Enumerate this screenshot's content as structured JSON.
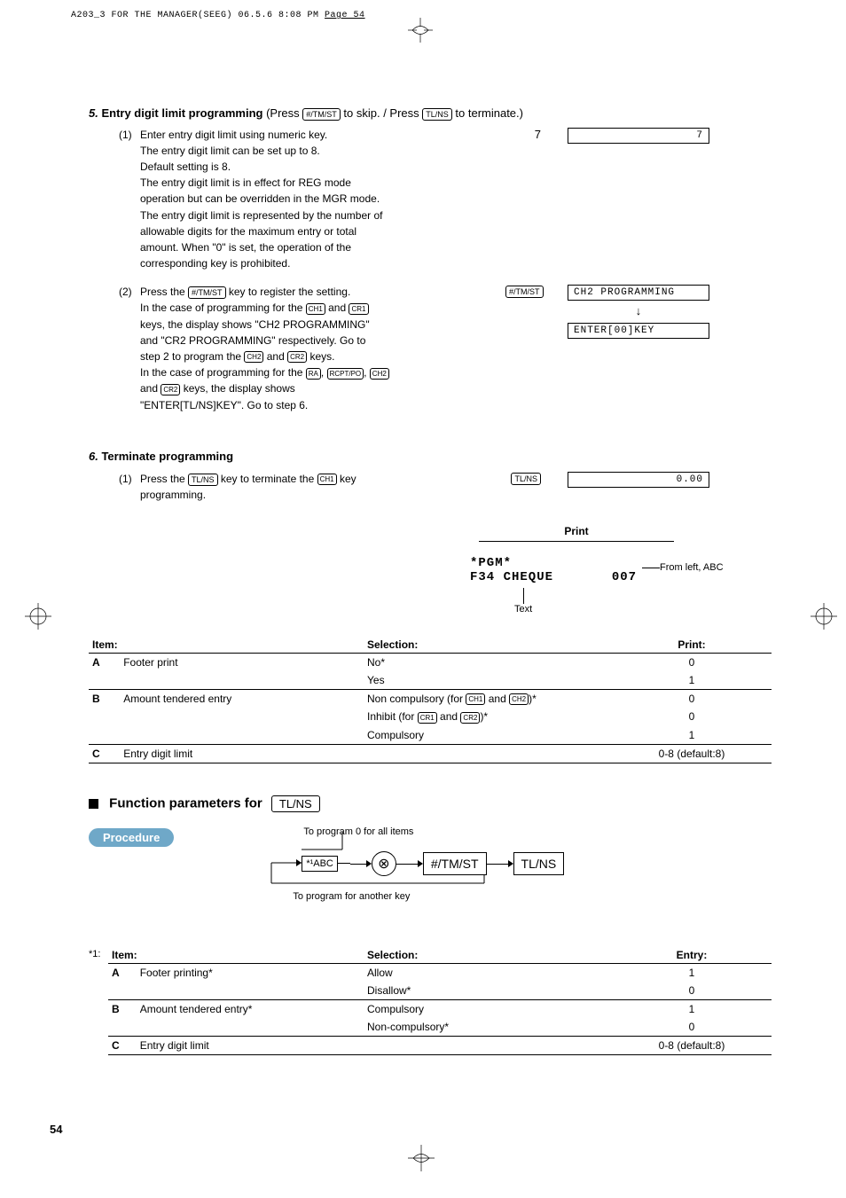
{
  "header": {
    "doc_header": "A203_3 FOR THE MANAGER(SEEG)  06.5.6 8:08 PM  ",
    "doc_header_page": "Page 54"
  },
  "step5": {
    "title_prefix": "5.",
    "title_bold": " Entry digit limit programming",
    "title_rest1": " (Press ",
    "key1": "#/TM/ST",
    "title_rest2": " to skip. / Press ",
    "key2": "TL/NS",
    "title_rest3": " to terminate.)",
    "s1": {
      "num": "(1)",
      "l1": "Enter entry digit limit using numeric key.",
      "l2": "The entry digit limit can be set up to 8.",
      "l3": "Default setting is 8.",
      "l4": "The entry digit limit is in effect for REG mode",
      "l5": "operation but can be overridden in the MGR mode.",
      "l6": "The entry digit limit is represented by the number of",
      "l7": "allowable digits for the maximum entry or total",
      "l8": "amount.  When \"0\" is set, the operation of the",
      "l9": "corresponding key is prohibited.",
      "right_num": "7",
      "right_disp": "7"
    },
    "s2": {
      "num": "(2)",
      "l1a": "Press the ",
      "l1key": "#/TM/ST",
      "l1b": " key to register the setting.",
      "l2a": "In the case of programming for the ",
      "l2key1": "CH1",
      "l2mid": " and ",
      "l2key2": "CR1",
      "l3": "keys, the display shows \"CH2 PROGRAMMING\"",
      "l4": "and \"CR2 PROGRAMMING\" respectively.  Go to",
      "l5a": "step 2 to program the ",
      "l5key1": "CH2",
      "l5mid": " and ",
      "l5key2": "CR2",
      "l5b": " keys.",
      "l6a": "In the case of programming for the ",
      "l6key1": "RA",
      "l6key2": "RCPT/PO",
      "l6key3": "CH2",
      "l7a": "and ",
      "l7key": "CR2",
      "l7b": " keys, the display shows",
      "l8": "\"ENTER[TL/NS]KEY\".  Go to step 6.",
      "right_key": "#/TM/ST",
      "right_disp1": "CH2 PROGRAMMING",
      "right_disp2": "ENTER[00]KEY"
    }
  },
  "step6": {
    "title_prefix": "6.",
    "title_bold": " Terminate programming",
    "s1": {
      "num": "(1)",
      "l1a": "Press the ",
      "l1key": "TL/NS",
      "l1b": " key to terminate the ",
      "l1key2": "CH1",
      "l1c": " key",
      "l2": "programming.",
      "right_key": "TL/NS",
      "right_disp": "0.00"
    },
    "print": {
      "title": "Print",
      "line1": "*PGM*",
      "line2": "F34 CHEQUE       007",
      "callout_text": "Text",
      "callout_right": "From left, ABC"
    }
  },
  "table1": {
    "h_item": "Item:",
    "h_sel": "Selection:",
    "h_print": "Print:",
    "rows": [
      {
        "code": "A",
        "item": "Footer print",
        "sel": "No*",
        "print": "0"
      },
      {
        "code": "",
        "item": "",
        "sel": "Yes",
        "print": "1"
      },
      {
        "code": "B",
        "item": "Amount tendered entry",
        "sel_pre": "Non compulsory (for ",
        "sel_k1": "CH1",
        "sel_mid": " and ",
        "sel_k2": "CH2",
        "sel_post": ")*",
        "print": "0"
      },
      {
        "code": "",
        "item": "",
        "sel_pre": "Inhibit (for ",
        "sel_k1": "CR1",
        "sel_mid": " and ",
        "sel_k2": "CR2",
        "sel_post": ")*",
        "print": "0"
      },
      {
        "code": "",
        "item": "",
        "sel": "Compulsory",
        "print": "1"
      },
      {
        "code": "C",
        "item": "Entry digit limit",
        "sel": "",
        "print": "0-8 (default:8)"
      }
    ]
  },
  "func": {
    "title_pre": "Function parameters for",
    "title_key": "TL/NS",
    "procedure": "Procedure",
    "caption_top": "To program   0  for all items",
    "box1": "*¹ABC",
    "circle": "⊗",
    "box2": "#/TM/ST",
    "box3": "TL/NS",
    "caption_bottom": "To program for another key"
  },
  "table2": {
    "note": "*1:",
    "h_item": "Item:",
    "h_sel": "Selection:",
    "h_entry": "Entry:",
    "rows": [
      {
        "code": "A",
        "item": "Footer printing*",
        "sel": "Allow",
        "entry": "1"
      },
      {
        "code": "",
        "item": "",
        "sel": "Disallow*",
        "entry": "0"
      },
      {
        "code": "B",
        "item": "Amount tendered entry*",
        "sel": "Compulsory",
        "entry": "1"
      },
      {
        "code": "",
        "item": "",
        "sel": "Non-compulsory*",
        "entry": "0"
      },
      {
        "code": "C",
        "item": "Entry digit limit",
        "sel": "",
        "entry": "0-8 (default:8)"
      }
    ]
  },
  "page_number": "54"
}
